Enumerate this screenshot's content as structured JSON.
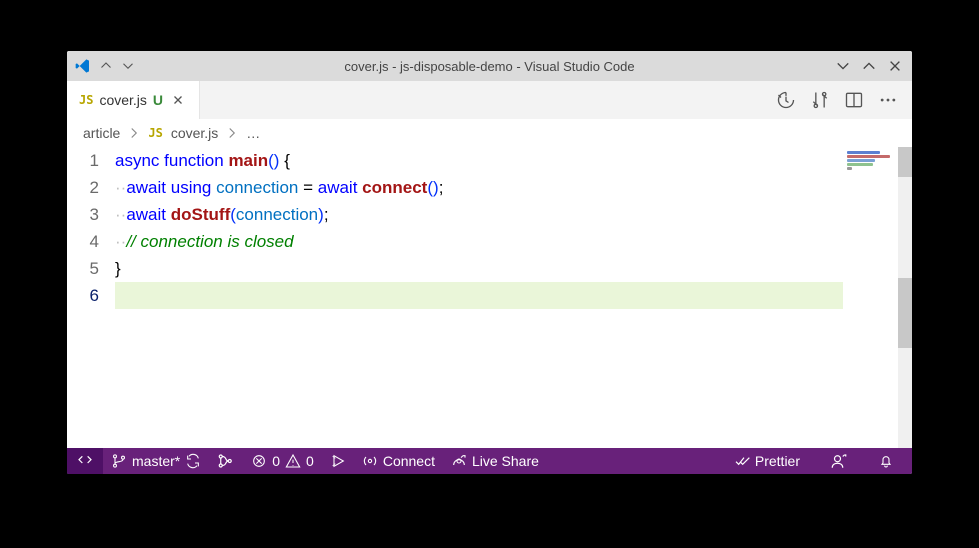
{
  "titlebar": {
    "title": "cover.js - js-disposable-demo - Visual Studio Code"
  },
  "tab": {
    "filename": "cover.js",
    "icon_label": "JS",
    "git_status": "U"
  },
  "breadcrumb": {
    "segments": [
      "article",
      "cover.js"
    ],
    "trailing": "…"
  },
  "editor": {
    "lines": [
      1,
      2,
      3,
      4,
      5,
      6
    ],
    "current_line": 6,
    "code": {
      "l1": {
        "kw_async": "async",
        "kw_function": "function",
        "fn": "main",
        "open": "(",
        "close": ")",
        "brace": " {"
      },
      "l2": {
        "dots": "··",
        "kw_await1": "await",
        "kw_using": "using",
        "var": "connection",
        "eq": " = ",
        "kw_await2": "await",
        "fn": "connect",
        "open": "(",
        "close": ")",
        "semi": ";"
      },
      "l3": {
        "dots": "··",
        "kw_await": "await",
        "fn": "doStuff",
        "open": "(",
        "arg": "connection",
        "close": ")",
        "semi": ";"
      },
      "l4": {
        "dots": "··",
        "comment": "// connection is closed"
      },
      "l5": {
        "brace": "}"
      }
    }
  },
  "statusbar": {
    "branch": "master*",
    "errors": "0",
    "warnings": "0",
    "connect": "Connect",
    "live_share": "Live Share",
    "prettier": "Prettier"
  }
}
